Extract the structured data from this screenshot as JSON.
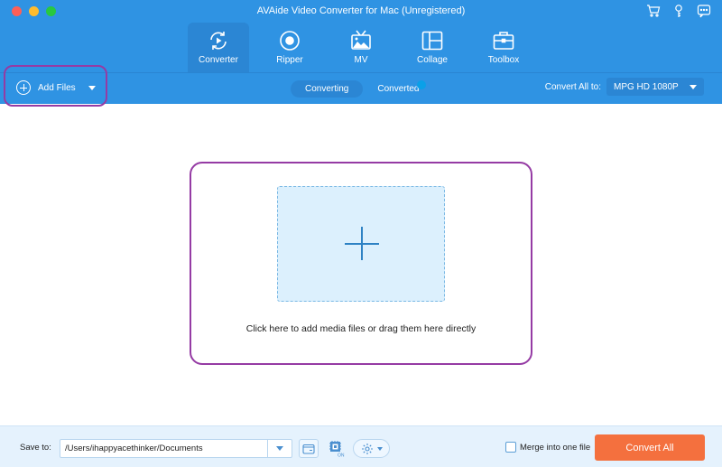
{
  "window": {
    "title": "AVAide Video Converter for Mac (Unregistered)",
    "top_icons": [
      "cart-icon",
      "key-icon",
      "feedback-icon"
    ]
  },
  "nav": {
    "items": [
      {
        "label": "Converter",
        "icon": "converter-icon",
        "active": true
      },
      {
        "label": "Ripper",
        "icon": "ripper-icon",
        "active": false
      },
      {
        "label": "MV",
        "icon": "mv-icon",
        "active": false
      },
      {
        "label": "Collage",
        "icon": "collage-icon",
        "active": false
      },
      {
        "label": "Toolbox",
        "icon": "toolbox-icon",
        "active": false
      }
    ]
  },
  "subbar": {
    "add_files_label": "Add Files",
    "tabs": [
      {
        "label": "Converting",
        "active": true
      },
      {
        "label": "Converted",
        "active": false
      }
    ],
    "convert_all_to_label": "Convert All to:",
    "format_value": "MPG HD 1080P"
  },
  "dropzone": {
    "text": "Click here to add media files or drag them here directly"
  },
  "footer": {
    "save_to_label": "Save to:",
    "save_path": "/Users/ihappyacethinker/Documents",
    "hw_accel_badge": "ON",
    "merge_label": "Merge into one file",
    "merge_checked": false,
    "convert_all_label": "Convert All"
  },
  "colors": {
    "header_bg": "#2f93e3",
    "active_tab_bg": "#2b86d4",
    "highlight_border": "#953ba4",
    "convert_button": "#f4703e",
    "footer_bg": "#e5f2fd"
  }
}
